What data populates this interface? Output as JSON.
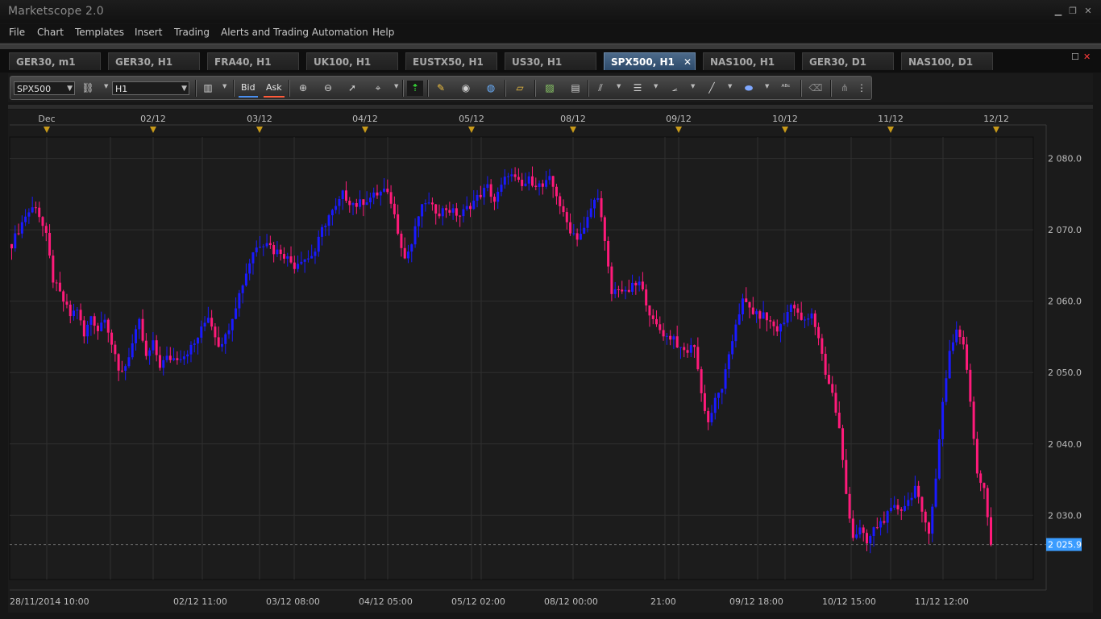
{
  "window": {
    "title": "Marketscope 2.0",
    "minimize_glyph": "▁",
    "restore_glyph": "❐",
    "close_glyph": "✕"
  },
  "menu": [
    "File",
    "Chart",
    "Templates",
    "Insert",
    "Trading",
    "Alerts and Trading Automation",
    "Help"
  ],
  "tabs": [
    {
      "label": "GER30, m1"
    },
    {
      "label": "GER30, H1"
    },
    {
      "label": "FRA40, H1"
    },
    {
      "label": "UK100, H1"
    },
    {
      "label": "EUSTX50, H1"
    },
    {
      "label": "US30, H1"
    },
    {
      "label": "SPX500, H1",
      "active": true,
      "close": "✕"
    },
    {
      "label": "NAS100, H1"
    },
    {
      "label": "GER30, D1"
    },
    {
      "label": "NAS100, D1"
    }
  ],
  "toolbar": {
    "instrument": "SPX500",
    "timeframe": "H1",
    "bid_label": "Bid",
    "ask_label": "Ask",
    "icons": [
      "candlestick-type-icon",
      "zoom-in-icon",
      "zoom-out-icon",
      "cursor-icon",
      "crosshair-icon",
      "indicator-icon",
      "notes-icon",
      "eye-icon",
      "globe-icon",
      "ruler-icon",
      "picture-icon",
      "template-icon",
      "channels-icon",
      "levels-icon",
      "fan-icon",
      "line-icon",
      "shape-icon",
      "text-icon",
      "eraser-icon",
      "tree-icon",
      "more-icon"
    ]
  },
  "chart_data": {
    "type": "candlestick",
    "instrument": "SPX500",
    "timeframe": "H1",
    "ylim": [
      2021,
      2083
    ],
    "y_ticks": [
      2030,
      2040,
      2050,
      2060,
      2070,
      2080
    ],
    "y_tick_labels": [
      "2 030.0",
      "2 040.0",
      "2 050.0",
      "2 060.0",
      "2 070.0",
      "2 080.0"
    ],
    "current_price": 2025.9,
    "current_price_label": "2 025.9",
    "top_axis_labels": [
      "Dec",
      "02/12",
      "03/12",
      "04/12",
      "05/12",
      "08/12",
      "09/12",
      "10/12",
      "11/12",
      "12/12"
    ],
    "bottom_axis_labels": [
      "28/11/2014 10:00",
      "02/12 11:00",
      "03/12 08:00",
      "04/12 05:00",
      "05/12 02:00",
      "08/12 00:00",
      "21:00",
      "09/12 18:00",
      "10/12 15:00",
      "11/12 12:00"
    ],
    "up_color": "#1a1aff",
    "down_color": "#ff1a7a",
    "path": [
      [
        0,
        2068
      ],
      [
        4,
        2072
      ],
      [
        7,
        2073.5
      ],
      [
        10,
        2069
      ],
      [
        12,
        2063
      ],
      [
        15,
        2060
      ],
      [
        17,
        2058
      ],
      [
        19,
        2059
      ],
      [
        21,
        2055
      ],
      [
        23,
        2058
      ],
      [
        25,
        2056
      ],
      [
        27,
        2058
      ],
      [
        29,
        2054
      ],
      [
        31,
        2050
      ],
      [
        33,
        2051
      ],
      [
        35,
        2054
      ],
      [
        37,
        2057
      ],
      [
        39,
        2052
      ],
      [
        41,
        2054
      ],
      [
        43,
        2051
      ],
      [
        45,
        2052
      ],
      [
        47,
        2052
      ],
      [
        50,
        2052.5
      ],
      [
        53,
        2054
      ],
      [
        55,
        2056
      ],
      [
        57,
        2058
      ],
      [
        60,
        2054
      ],
      [
        62,
        2055
      ],
      [
        64,
        2058
      ],
      [
        66,
        2061
      ],
      [
        68,
        2064
      ],
      [
        70,
        2067
      ],
      [
        72,
        2068
      ],
      [
        74,
        2068.5
      ],
      [
        76,
        2067
      ],
      [
        78,
        2067
      ],
      [
        80,
        2066
      ],
      [
        82,
        2065
      ],
      [
        84,
        2066
      ],
      [
        86,
        2066
      ],
      [
        88,
        2067
      ],
      [
        90,
        2070
      ],
      [
        92,
        2072
      ],
      [
        94,
        2073
      ],
      [
        96,
        2075
      ],
      [
        98,
        2074
      ],
      [
        100,
        2073.5
      ],
      [
        102,
        2074
      ],
      [
        104,
        2074.5
      ],
      [
        106,
        2075
      ],
      [
        108,
        2075.5
      ],
      [
        110,
        2074
      ],
      [
        112,
        2070
      ],
      [
        114,
        2066
      ],
      [
        116,
        2068
      ],
      [
        118,
        2072
      ],
      [
        120,
        2074
      ],
      [
        122,
        2073
      ],
      [
        124,
        2072.5
      ],
      [
        126,
        2073
      ],
      [
        128,
        2072.5
      ],
      [
        130,
        2072
      ],
      [
        132,
        2073
      ],
      [
        134,
        2074
      ],
      [
        136,
        2075
      ],
      [
        138,
        2076
      ],
      [
        140,
        2074
      ],
      [
        142,
        2076
      ],
      [
        144,
        2078
      ],
      [
        146,
        2077
      ],
      [
        148,
        2076
      ],
      [
        150,
        2077
      ],
      [
        152,
        2076.5
      ],
      [
        154,
        2076
      ],
      [
        156,
        2077
      ],
      [
        158,
        2075
      ],
      [
        160,
        2072
      ],
      [
        162,
        2070
      ],
      [
        164,
        2069
      ],
      [
        166,
        2070
      ],
      [
        168,
        2073
      ],
      [
        170,
        2075
      ],
      [
        172,
        2068
      ],
      [
        174,
        2061
      ],
      [
        176,
        2062
      ],
      [
        178,
        2061
      ],
      [
        180,
        2062
      ],
      [
        182,
        2062.5
      ],
      [
        184,
        2060
      ],
      [
        186,
        2057
      ],
      [
        188,
        2056
      ],
      [
        190,
        2055
      ],
      [
        192,
        2055
      ],
      [
        194,
        2053
      ],
      [
        196,
        2053
      ],
      [
        198,
        2054
      ],
      [
        200,
        2047
      ],
      [
        202,
        2043
      ],
      [
        204,
        2046
      ],
      [
        206,
        2048
      ],
      [
        208,
        2052
      ],
      [
        210,
        2057
      ],
      [
        212,
        2060
      ],
      [
        214,
        2059
      ],
      [
        216,
        2058
      ],
      [
        218,
        2058
      ],
      [
        220,
        2057
      ],
      [
        222,
        2056
      ],
      [
        224,
        2057
      ],
      [
        226,
        2060
      ],
      [
        228,
        2058
      ],
      [
        230,
        2057
      ],
      [
        232,
        2058
      ],
      [
        234,
        2055
      ],
      [
        236,
        2050
      ],
      [
        238,
        2047
      ],
      [
        240,
        2042
      ],
      [
        242,
        2033
      ],
      [
        244,
        2027
      ],
      [
        246,
        2028
      ],
      [
        248,
        2026
      ],
      [
        250,
        2028
      ],
      [
        252,
        2029
      ],
      [
        254,
        2030
      ],
      [
        256,
        2031
      ],
      [
        258,
        2031
      ],
      [
        260,
        2032
      ],
      [
        262,
        2034
      ],
      [
        264,
        2030
      ],
      [
        266,
        2028
      ],
      [
        268,
        2035
      ],
      [
        270,
        2046
      ],
      [
        272,
        2053
      ],
      [
        274,
        2056
      ],
      [
        276,
        2054
      ],
      [
        278,
        2046
      ],
      [
        280,
        2036
      ],
      [
        282,
        2034
      ],
      [
        284,
        2026
      ]
    ]
  }
}
